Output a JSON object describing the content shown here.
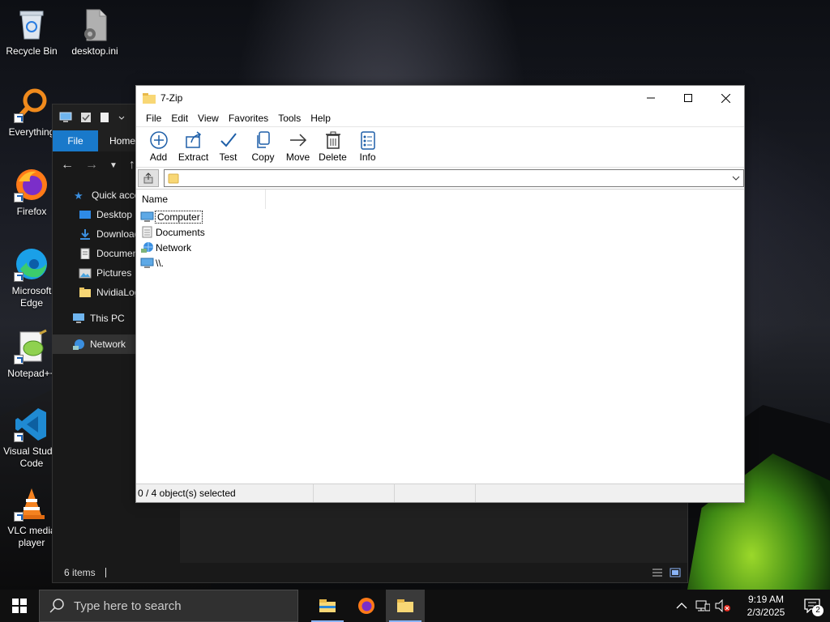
{
  "desktop": {
    "icons": [
      {
        "label": "Recycle Bin"
      },
      {
        "label": "desktop.ini"
      },
      {
        "label": "Everything"
      },
      {
        "label": "Firefox"
      },
      {
        "label": "Microsoft Edge"
      },
      {
        "label": "Notepad++"
      },
      {
        "label": "Visual Studio Code"
      },
      {
        "label": "VLC media player"
      }
    ]
  },
  "explorer": {
    "ribbon": {
      "file": "File",
      "home": "Home"
    },
    "sidebar": [
      {
        "label": "Quick access"
      },
      {
        "label": "Desktop"
      },
      {
        "label": "Downloads"
      },
      {
        "label": "Documents"
      },
      {
        "label": "Pictures"
      },
      {
        "label": "NvidiaLogs"
      },
      {
        "label": "This PC"
      },
      {
        "label": "Network"
      }
    ],
    "status": "6 items"
  },
  "zip": {
    "title": "7-Zip",
    "menu": [
      "File",
      "Edit",
      "View",
      "Favorites",
      "Tools",
      "Help"
    ],
    "toolbar": [
      "Add",
      "Extract",
      "Test",
      "Copy",
      "Move",
      "Delete",
      "Info"
    ],
    "address": "",
    "column": "Name",
    "rows": [
      {
        "name": "Computer",
        "icon": "computer-icon"
      },
      {
        "name": "Documents",
        "icon": "documents-icon"
      },
      {
        "name": "Network",
        "icon": "network-icon"
      },
      {
        "name": "\\\\.",
        "icon": "computer-icon"
      }
    ],
    "status": "0 / 4 object(s) selected"
  },
  "taskbar": {
    "search_placeholder": "Type here to search",
    "time": "9:19 AM",
    "date": "2/3/2025",
    "notifications": "2"
  },
  "colors": {
    "accent": "#1979ca",
    "taskbar": "#101010",
    "folder": "#f8d775"
  }
}
